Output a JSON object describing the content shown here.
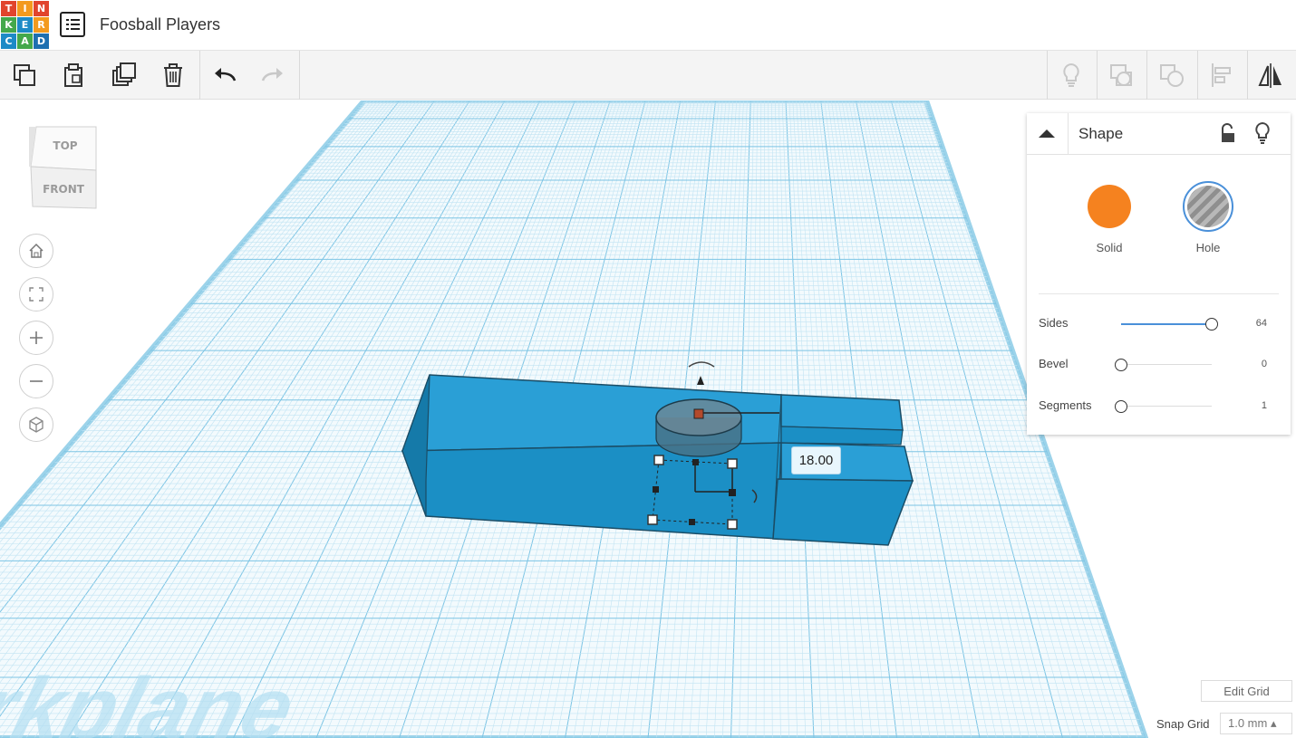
{
  "header": {
    "logo_letters": [
      "T",
      "I",
      "N",
      "K",
      "E",
      "R",
      "C",
      "A",
      "D"
    ],
    "project_title": "Foosball Players"
  },
  "toolbar": {
    "left_tools": [
      "copy-icon",
      "paste-icon",
      "duplicate-icon",
      "delete-icon",
      "undo-icon",
      "redo-icon"
    ],
    "right_tools": [
      "note-icon",
      "group-icon",
      "ungroup-icon",
      "align-icon",
      "mirror-icon"
    ]
  },
  "viewcube": {
    "top": "TOP",
    "front": "FRONT"
  },
  "nav": [
    "home-view-icon",
    "fit-view-icon",
    "zoom-in-icon",
    "zoom-out-icon",
    "perspective-icon"
  ],
  "shape_panel": {
    "title": "Shape",
    "solid_label": "Solid",
    "hole_label": "Hole",
    "solid_color": "#f5821f",
    "hole_ring_color": "#4a90d9",
    "props": [
      {
        "label": "Sides",
        "value": "64",
        "level": 1.0
      },
      {
        "label": "Bevel",
        "value": "0",
        "level": 0
      },
      {
        "label": "Segments",
        "value": "1",
        "level": 0
      }
    ]
  },
  "workplane": {
    "dimension_value": "18.00",
    "watermark": "Workplane",
    "shape_color": "#1b8fc5"
  },
  "grid_controls": {
    "edit_grid": "Edit Grid",
    "snap_grid_label": "Snap Grid",
    "snap_grid_value": "1.0 mm ▴"
  }
}
